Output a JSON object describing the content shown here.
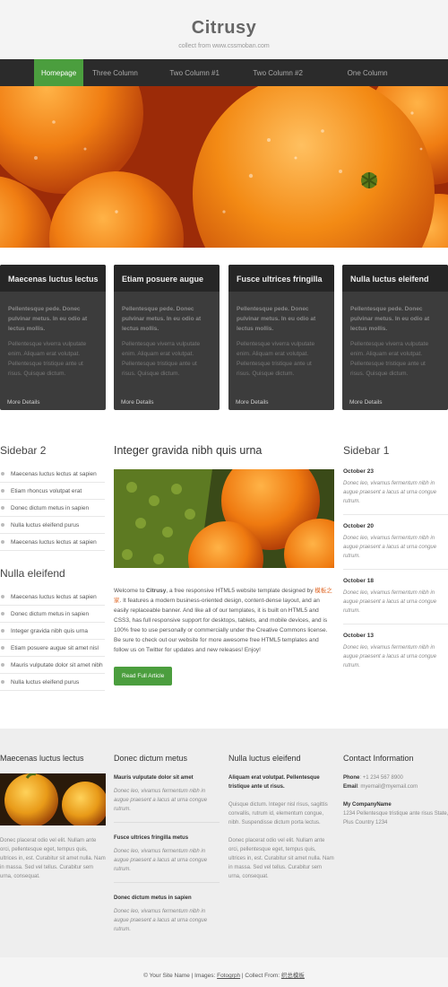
{
  "header": {
    "title": "Citrusy",
    "subtitle": "collect from www.cssmoban.com"
  },
  "nav": {
    "items": [
      "Homepage",
      "Three Column",
      "Two Column #1",
      "Two Column #2",
      "One Column"
    ]
  },
  "features": [
    {
      "title": "Maecenas luctus lectus",
      "bold": "Pellentesque pede. Donec pulvinar metus. In eu odio at lectus mollis.",
      "text": "Pellentesque viverra vulputate enim. Aliquam erat volutpat. Pellentesque tristique ante ut risus. Quisque dictum.",
      "more": "More Details"
    },
    {
      "title": "Etiam posuere augue",
      "bold": "Pellentesque pede. Donec pulvinar metus. In eu odio at lectus mollis.",
      "text": "Pellentesque viverra vulputate enim. Aliquam erat volutpat. Pellentesque tristique ante ut risus. Quisque dictum.",
      "more": "More Details"
    },
    {
      "title": "Fusce ultrices fringilla",
      "bold": "Pellentesque pede. Donec pulvinar metus. In eu odio at lectus mollis.",
      "text": "Pellentesque viverra vulputate enim. Aliquam erat volutpat. Pellentesque tristique ante ut risus. Quisque dictum.",
      "more": "More Details"
    },
    {
      "title": "Nulla luctus eleifend",
      "bold": "Pellentesque pede. Donec pulvinar metus. In eu odio at lectus mollis.",
      "text": "Pellentesque viverra vulputate enim. Aliquam erat volutpat. Pellentesque tristique ante ut risus. Quisque dictum.",
      "more": "More Details"
    }
  ],
  "sidebar2": {
    "heading": "Sidebar 2",
    "items": [
      "Maecenas luctus lectus at sapien",
      "Etiam rhoncus volutpat erat",
      "Donec dictum metus in sapien",
      "Nulla luctus eleifend purus",
      "Maecenas luctus lectus at sapien"
    ],
    "heading2": "Nulla eleifend",
    "items2": [
      "Maecenas luctus lectus at sapien",
      "Donec dictum metus in sapien",
      "Integer gravida nibh quis urna",
      "Etiam posuere augue sit amet nisl",
      "Mauris vulputate dolor sit amet nibh",
      "Nulla luctus eleifend purus"
    ]
  },
  "main": {
    "heading": "Integer gravida nibh quis urna",
    "body_pre": "Welcome to ",
    "body_brand": "Citrusy",
    "body_mid": ", a free responsive HTML5 website template designed by ",
    "body_link": "模板之家",
    "body_post": ". It features a modern business-oriented design, content-dense layout, and an easily replaceable banner. And like all of our templates, it is built on HTML5 and CSS3, has full responsive support for desktops, tablets, and mobile devices, and is 100% free to use personally or commercially under the Creative Commons license. Be sure to check out our website for more awesome free HTML5 templates and follow us on Twitter for updates and new releases! Enjoy!",
    "button": "Read Full Article"
  },
  "sidebar1": {
    "heading": "Sidebar 1",
    "events": [
      {
        "date": "October 23",
        "text": "Donec leo, vivamus fermentum nibh in augue praesent a lacus at urna congue rutrum."
      },
      {
        "date": "October 20",
        "text": "Donec leo, vivamus fermentum nibh in augue praesent a lacus at urna congue rutrum."
      },
      {
        "date": "October 18",
        "text": "Donec leo, vivamus fermentum nibh in augue praesent a lacus at urna congue rutrum."
      },
      {
        "date": "October 13",
        "text": "Donec leo, vivamus fermentum nibh in augue praesent a lacus at urna congue rutrum."
      }
    ]
  },
  "footer": {
    "col1": {
      "heading": "Maecenas luctus lectus",
      "text": "Donec placerat odio vel elit. Nullam ante orci, pellentesque eget, tempus quis, ultrices in, est. Curabitur sit amet nulla. Nam in massa. Sed vel tellus. Curabitur sem urna, consequat."
    },
    "col2": {
      "heading": "Donec dictum metus",
      "entries": [
        {
          "title": "Mauris vulputate dolor sit amet",
          "text": "Donec leo, vivamus fermentum nibh in augue praesent a lacus at urna congue rutrum."
        },
        {
          "title": "Fusce ultrices fringilla metus",
          "text": "Donec leo, vivamus fermentum nibh in augue praesent a lacus at urna congue rutrum."
        },
        {
          "title": "Donec dictum metus in sapien",
          "text": "Donec leo, vivamus fermentum nibh in augue praesent a lacus at urna congue rutrum."
        }
      ]
    },
    "col3": {
      "heading": "Nulla luctus eleifend",
      "bold": "Aliquam erat volutpat. Pellentesque tristique ante ut risus.",
      "text1": "Quisque dictum. Integer nisl risus, sagittis convallis, rutrum id, elementum congue, nibh. Suspendisse dictum porta lectus.",
      "text2": "Donec placerat odio vel elit. Nullam ante orci, pellentesque eget, tempus quis, ultrices in, est. Curabitur sit amet nulla. Nam in massa. Sed vel tellus. Curabitur sem urna, consequat."
    },
    "col4": {
      "heading": "Contact Information",
      "phone_label": "Phone",
      "phone": "+1 234 567 8900",
      "email_label": "Email",
      "email": "myemail@myemail.com",
      "company": "My CompanyName",
      "address": "1234 Pellentesque tristique ante risus State, Plus Country 1234"
    }
  },
  "bottom": {
    "copyright": "© Your Site Name | Images: ",
    "images_link": "Fotogrph",
    "collect": " | Collect From: ",
    "collect_link": "织总模板"
  },
  "colors": {
    "accent": "#4b9e3e",
    "nav_bg": "#2b2b2b",
    "box_bg": "#3c3c3c",
    "link": "#e06a2a"
  }
}
